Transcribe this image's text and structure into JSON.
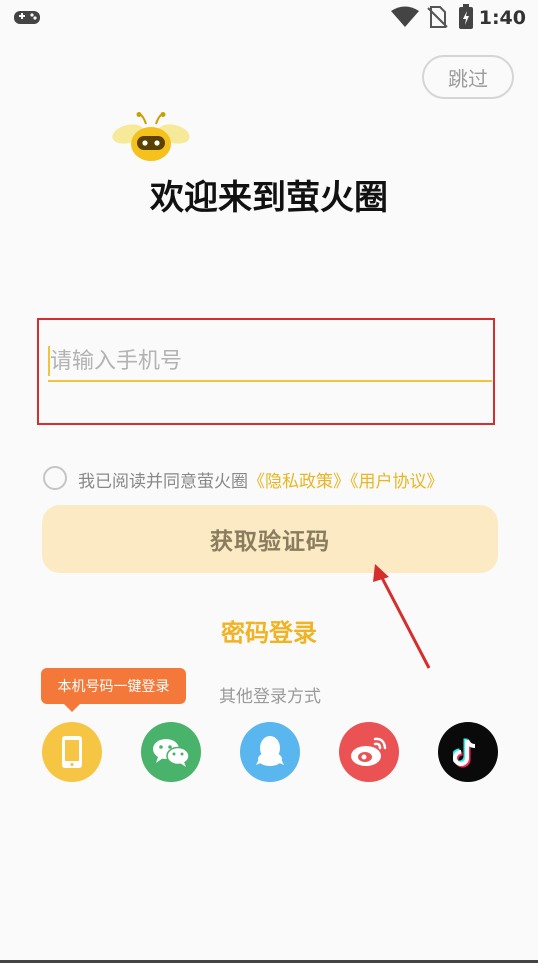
{
  "status_bar": {
    "time": "1:40"
  },
  "header": {
    "skip_label": "跳过",
    "welcome_title": "欢迎来到萤火圈"
  },
  "login": {
    "phone_placeholder": "请输入手机号",
    "agreement_text": "我已阅读并同意萤火圈",
    "privacy_link": "《隐私政策》",
    "user_agreement_link": "《用户协议》",
    "get_code_label": "获取验证码",
    "password_login_label": "密码登录"
  },
  "other_login": {
    "label": "其他登录方式",
    "tooltip": "本机号码一键登录",
    "methods": [
      {
        "icon": "phone-icon"
      },
      {
        "icon": "wechat-icon"
      },
      {
        "icon": "qq-icon"
      },
      {
        "icon": "weibo-icon"
      },
      {
        "icon": "tiktok-icon"
      }
    ]
  },
  "colors": {
    "accent": "#f0c53c",
    "primary_button": "#fbeac4",
    "link": "#e9b622",
    "tooltip": "#f5783b",
    "annotation": "#d62d2d"
  }
}
